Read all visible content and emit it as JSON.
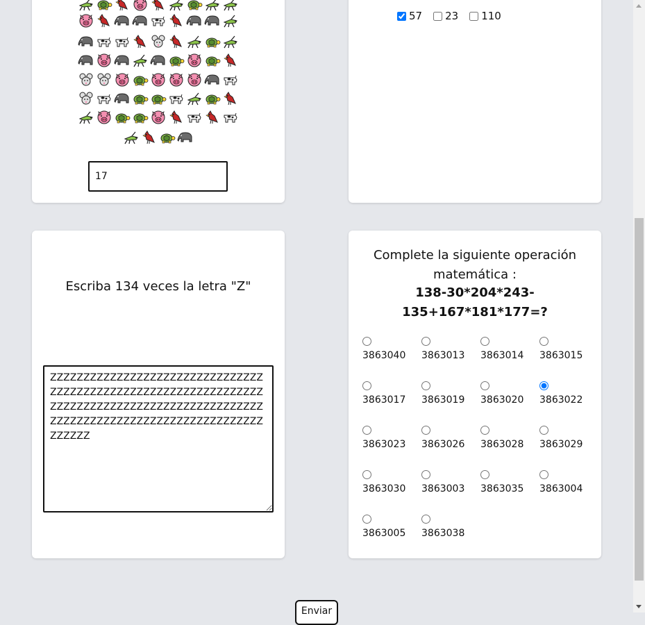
{
  "animal_grid": {
    "rows": [
      [
        "grasshopper",
        "turtle",
        "cardinal",
        "pig",
        "cardinal",
        "grasshopper",
        "turtle",
        "grasshopper",
        "grasshopper"
      ],
      [
        "pig",
        "cardinal",
        "elephant",
        "elephant",
        "cow",
        "cardinal",
        "elephant",
        "elephant",
        "grasshopper"
      ],
      [
        "elephant",
        "cow",
        "cow",
        "cardinal",
        "mouse",
        "cardinal",
        "grasshopper",
        "turtle",
        "grasshopper"
      ],
      [
        "elephant",
        "pig",
        "elephant",
        "grasshopper",
        "elephant",
        "turtle",
        "pig",
        "turtle",
        "cardinal"
      ],
      [
        "mouse",
        "mouse",
        "pig",
        "turtle",
        "pig",
        "pig",
        "pig",
        "elephant",
        "cow"
      ],
      [
        "mouse",
        "cow",
        "elephant",
        "turtle",
        "turtle",
        "cow",
        "grasshopper",
        "turtle",
        "cardinal"
      ],
      [
        "grasshopper",
        "pig",
        "turtle",
        "turtle",
        "pig",
        "cardinal",
        "cow",
        "cardinal",
        "cow"
      ],
      [
        "grasshopper",
        "cardinal",
        "turtle",
        "elephant"
      ]
    ],
    "count_value": "17"
  },
  "checkbox_question": {
    "options": [
      {
        "label": "57",
        "checked": true
      },
      {
        "label": "23",
        "checked": false
      },
      {
        "label": "110",
        "checked": false
      }
    ]
  },
  "letters_question": {
    "prompt": "Escriba 134 veces la letra \"Z\"",
    "answer": "ZZZZZZZZZZZZZZZZZZZZZZZZZZZZZZZZZZZZZZZZZZZZZZZZZZZZZZZZZZZZZZZZZZZZZZZZZZZZZZZZZZZZZZZZZZZZZZZZZZZZZZZZZZZZZZZZZZZZZZZZZZZZZZZZZZZZZZ"
  },
  "math_question": {
    "title": "Complete la siguiente operación matemática :",
    "expression": "138-30*204*243-135+167*181*177=?",
    "options": [
      {
        "label": "3863040",
        "selected": false
      },
      {
        "label": "3863013",
        "selected": false
      },
      {
        "label": "3863014",
        "selected": false
      },
      {
        "label": "3863015",
        "selected": false
      },
      {
        "label": "3863017",
        "selected": false
      },
      {
        "label": "3863019",
        "selected": false
      },
      {
        "label": "3863020",
        "selected": false
      },
      {
        "label": "3863022",
        "selected": true
      },
      {
        "label": "3863023",
        "selected": false
      },
      {
        "label": "3863026",
        "selected": false
      },
      {
        "label": "3863028",
        "selected": false
      },
      {
        "label": "3863029",
        "selected": false
      },
      {
        "label": "3863030",
        "selected": false
      },
      {
        "label": "3863003",
        "selected": false
      },
      {
        "label": "3863035",
        "selected": false
      },
      {
        "label": "3863004",
        "selected": false
      },
      {
        "label": "3863005",
        "selected": false
      },
      {
        "label": "3863038",
        "selected": false
      }
    ]
  },
  "submit_button": {
    "label": "Enviar"
  },
  "colors": {
    "page_bg": "#e5e7eb",
    "card_bg": "#ffffff",
    "grasshopper": "#8bc34a",
    "turtle": "#7cb342",
    "cardinal": "#c62828",
    "pig": "#f48fb1",
    "elephant": "#6b6b6b",
    "cow": "#ffffff",
    "mouse": "#e0e0e0"
  }
}
